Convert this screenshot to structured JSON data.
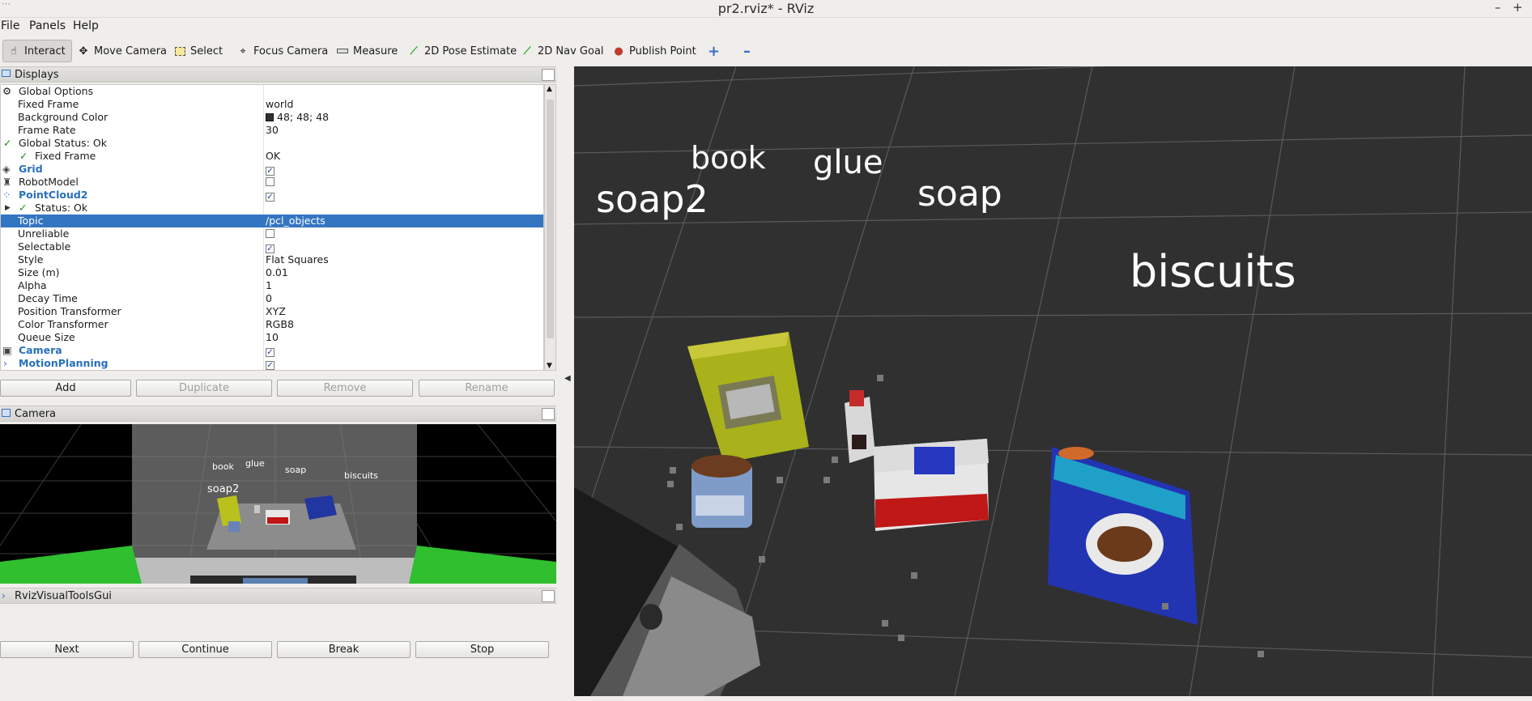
{
  "window": {
    "title": "pr2.rviz* - RViz",
    "min_label": "–",
    "max_label": "+"
  },
  "menu": {
    "file": "File",
    "panels": "Panels",
    "help": "Help"
  },
  "toolbar": {
    "interact": "Interact",
    "move_camera": "Move Camera",
    "select": "Select",
    "focus_camera": "Focus Camera",
    "measure": "Measure",
    "pose_estimate": "2D Pose Estimate",
    "nav_goal": "2D Nav Goal",
    "publish_point": "Publish Point",
    "add_icon": "+",
    "remove_icon": "–"
  },
  "displays": {
    "title": "Displays",
    "rows": [
      {
        "key": "Global Options",
        "value": ""
      },
      {
        "key": "Fixed Frame",
        "value": "world"
      },
      {
        "key": "Background Color",
        "value": "48; 48; 48"
      },
      {
        "key": "Frame Rate",
        "value": "30"
      },
      {
        "key": "Global Status: Ok",
        "value": ""
      },
      {
        "key": "Fixed Frame",
        "value": "OK"
      },
      {
        "key": "Grid",
        "value": ""
      },
      {
        "key": "RobotModel",
        "value": ""
      },
      {
        "key": "PointCloud2",
        "value": ""
      },
      {
        "key": "Status: Ok",
        "value": ""
      },
      {
        "key": "Topic",
        "value": "/pcl_objects"
      },
      {
        "key": "Unreliable",
        "value": ""
      },
      {
        "key": "Selectable",
        "value": ""
      },
      {
        "key": "Style",
        "value": "Flat Squares"
      },
      {
        "key": "Size (m)",
        "value": "0.01"
      },
      {
        "key": "Alpha",
        "value": "1"
      },
      {
        "key": "Decay Time",
        "value": "0"
      },
      {
        "key": "Position Transformer",
        "value": "XYZ"
      },
      {
        "key": "Color Transformer",
        "value": "RGB8"
      },
      {
        "key": "Queue Size",
        "value": "10"
      },
      {
        "key": "Camera",
        "value": ""
      },
      {
        "key": "MotionPlanning",
        "value": ""
      }
    ],
    "checks": {
      "grid": true,
      "robot_model": false,
      "pointcloud2": true,
      "unreliable": false,
      "selectable": true,
      "camera": true,
      "motion_planning": true
    },
    "buttons": {
      "add": "Add",
      "duplicate": "Duplicate",
      "remove": "Remove",
      "rename": "Rename"
    }
  },
  "camera_panel": {
    "title": "Camera",
    "labels": [
      "book",
      "glue",
      "soap",
      "biscuits",
      "soap2"
    ]
  },
  "visual_tools": {
    "title": "RvizVisualToolsGui",
    "buttons": {
      "next": "Next",
      "continue": "Continue",
      "break": "Break",
      "stop": "Stop"
    }
  },
  "viewport": {
    "background_color": "#303030",
    "labels": {
      "book": "book",
      "glue": "glue",
      "soap2": "soap2",
      "soap": "soap",
      "biscuits": "biscuits"
    }
  }
}
